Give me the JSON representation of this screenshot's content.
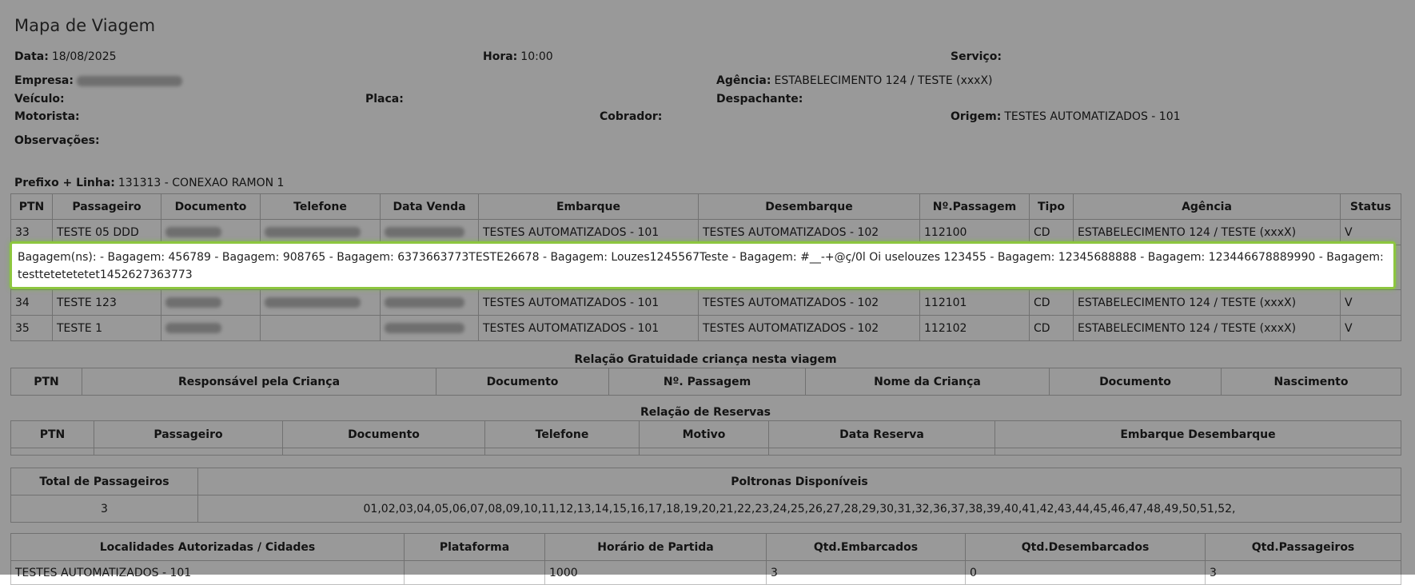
{
  "header": {
    "title": "Mapa de Viagem",
    "data_label": "Data:",
    "data_value": "18/08/2025",
    "hora_label": "Hora:",
    "hora_value": "10:00",
    "servico_label": "Serviço:",
    "empresa_label": "Empresa:",
    "agencia_label": "Agência:",
    "agencia_value": "ESTABELECIMENTO 124 / TESTE (xxxX)",
    "veiculo_label": "Veículo:",
    "placa_label": "Placa:",
    "despachante_label": "Despachante:",
    "motorista_label": "Motorista:",
    "cobrador_label": "Cobrador:",
    "origem_label": "Origem:",
    "origem_value": "TESTES AUTOMATIZADOS - 101",
    "observacoes_label": "Observações:",
    "prefixo_label": "Prefixo + Linha:",
    "prefixo_value": "131313 - CONEXAO RAMON 1"
  },
  "passengers": {
    "headers": [
      "PTN",
      "Passageiro",
      "Documento",
      "Telefone",
      "Data Venda",
      "Embarque",
      "Desembarque",
      "Nº.Passagem",
      "Tipo",
      "Agência",
      "Status"
    ],
    "rows": [
      {
        "ptn": "33",
        "nome": "TESTE 05 DDD",
        "embarque": "TESTES AUTOMATIZADOS - 101",
        "desembarque": "TESTES AUTOMATIZADOS - 102",
        "passagem": "112100",
        "tipo": "CD",
        "agencia": "ESTABELECIMENTO 124 / TESTE (xxxX)",
        "status": "V"
      },
      {
        "ptn": "34",
        "nome": "TESTE 123",
        "embarque": "TESTES AUTOMATIZADOS - 101",
        "desembarque": "TESTES AUTOMATIZADOS - 102",
        "passagem": "112101",
        "tipo": "CD",
        "agencia": "ESTABELECIMENTO 124 / TESTE (xxxX)",
        "status": "V"
      },
      {
        "ptn": "35",
        "nome": "TESTE 1",
        "embarque": "TESTES AUTOMATIZADOS - 101",
        "desembarque": "TESTES AUTOMATIZADOS - 102",
        "passagem": "112102",
        "tipo": "CD",
        "agencia": "ESTABELECIMENTO 124 / TESTE (xxxX)",
        "status": "V"
      }
    ]
  },
  "popup": {
    "text": "Bagagem(ns): - Bagagem: 456789 - Bagagem: 908765 - Bagagem: 6373663773TESTE26678 - Bagagem: Louzes1245567Teste - Bagagem: #__-+@ç/0l Oi uselouzes 123455 - Bagagem: 12345688888 - Bagagem: 123446678889990 - Bagagem: testtetetetetet1452627363773"
  },
  "gratuidade": {
    "title": "Relação Gratuidade criança nesta viagem",
    "headers": [
      "PTN",
      "Responsável pela Criança",
      "Documento",
      "Nº. Passagem",
      "Nome da Criança",
      "Documento",
      "Nascimento"
    ]
  },
  "reservas": {
    "title": "Relação de Reservas",
    "headers": [
      "PTN",
      "Passageiro",
      "Documento",
      "Telefone",
      "Motivo",
      "Data Reserva",
      "Embarque Desembarque"
    ]
  },
  "totais": {
    "total_label": "Total de Passageiros",
    "poltronas_label": "Poltronas Disponíveis",
    "total_value": "3",
    "poltronas_value": "01,02,03,04,05,06,07,08,09,10,11,12,13,14,15,16,17,18,19,20,21,22,23,24,25,26,27,28,29,30,31,32,36,37,38,39,40,41,42,43,44,45,46,47,48,49,50,51,52,"
  },
  "localidades": {
    "headers": [
      "Localidades Autorizadas / Cidades",
      "Plataforma",
      "Horário de Partida",
      "Qtd.Embarcados",
      "Qtd.Desembarcados",
      "Qtd.Passageiros"
    ],
    "row": [
      "TESTES AUTOMATIZADOS - 101",
      "",
      "1000",
      "3",
      "0",
      "3"
    ]
  }
}
